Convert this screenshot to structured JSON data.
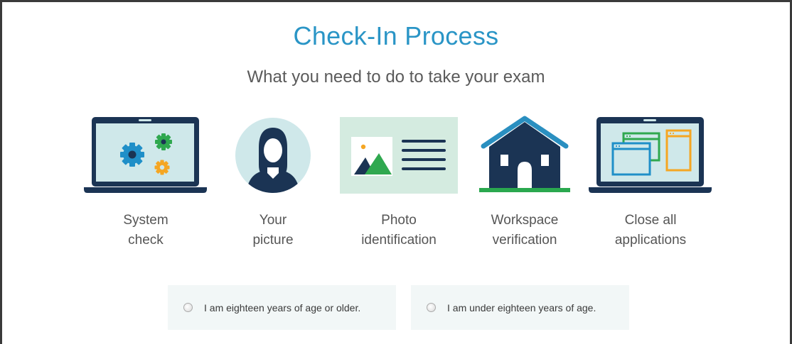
{
  "header": {
    "title": "Check-In Process",
    "subtitle": "What you need to do to take your exam"
  },
  "steps": [
    {
      "icon": "laptop-gears-icon",
      "line1": "System",
      "line2": "check"
    },
    {
      "icon": "person-avatar-icon",
      "line1": "Your",
      "line2": "picture"
    },
    {
      "icon": "id-card-icon",
      "line1": "Photo",
      "line2": "identification"
    },
    {
      "icon": "house-icon",
      "line1": "Workspace",
      "line2": "verification"
    },
    {
      "icon": "laptop-windows-icon",
      "line1": "Close all",
      "line2": "applications"
    }
  ],
  "age_options": [
    {
      "label": "I am eighteen years of age or older.",
      "selected": false
    },
    {
      "label": "I am under eighteen years of age.",
      "selected": false
    }
  ],
  "colors": {
    "title": "#2a95c6",
    "navy": "#1b3454",
    "screen": "#cfe8ea",
    "blue_gear": "#1f8fc8",
    "green_gear": "#2fa84f",
    "orange_gear": "#f5a623",
    "green_accent": "#2aa84f",
    "roof_blue": "#2a8fc0"
  }
}
